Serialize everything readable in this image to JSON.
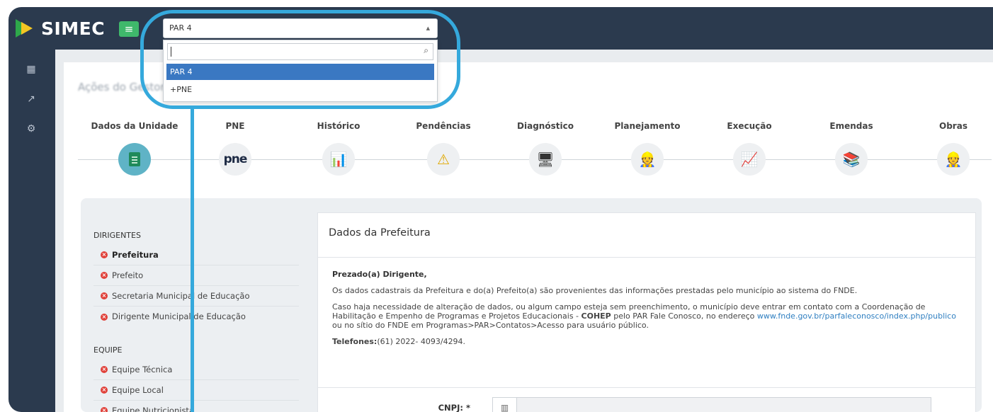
{
  "app": {
    "logo_text": "SIMEC",
    "menu_icon": "hamburger-icon"
  },
  "sidebar": {
    "icons": [
      "grid-icon",
      "chart-icon",
      "cogs-icon"
    ]
  },
  "page": {
    "title": "Ações do Gestor"
  },
  "select": {
    "value": "PAR 4",
    "search_value": "",
    "options": [
      {
        "label": "PAR 4",
        "selected": true
      },
      {
        "label": "+PNE",
        "selected": false
      }
    ]
  },
  "steps": [
    {
      "label": "Dados da Unidade",
      "icon": "document-icon",
      "active": true
    },
    {
      "label": "PNE",
      "icon": "pne-logo",
      "glyph": "pne",
      "active": false
    },
    {
      "label": "Histórico",
      "icon": "presentation-chart-icon",
      "glyph": "📊",
      "active": false
    },
    {
      "label": "Pendências",
      "icon": "warning-icon",
      "glyph": "⚠",
      "active": false
    },
    {
      "label": "Diagnóstico",
      "icon": "monitor-icon",
      "glyph": "🖥",
      "active": false
    },
    {
      "label": "Planejamento",
      "icon": "planner-person-icon",
      "glyph": "👷",
      "active": false
    },
    {
      "label": "Execução",
      "icon": "execution-chart-icon",
      "glyph": "📈",
      "active": false
    },
    {
      "label": "Emendas",
      "icon": "amendments-icon",
      "glyph": "📚",
      "active": false
    },
    {
      "label": "Obras",
      "icon": "worker-icon",
      "glyph": "👷",
      "active": false
    }
  ],
  "left_menu": {
    "sections": [
      {
        "title": "DIRIGENTES",
        "items": [
          "Prefeitura",
          "Prefeito",
          "Secretaria Municipal de Educação",
          "Dirigente Municipal de Educação"
        ]
      },
      {
        "title": "EQUIPE",
        "items": [
          "Equipe Técnica",
          "Equipe Local",
          "Equipe Nutricionista"
        ]
      }
    ]
  },
  "card": {
    "title": "Dados da Prefeitura",
    "greeting": "Prezado(a) Dirigente,",
    "paragraph1": "Os dados cadastrais da Prefeitura e do(a) Prefeito(a) são provenientes das informações prestadas pelo município ao sistema do FNDE.",
    "paragraph2_a": "Caso haja necessidade de alteração de dados, ou algum campo esteja sem preenchimento, o município deve entrar em contato com a Coordenação de Habilitação e Empenho de Programas e Projetos Educacionais - ",
    "paragraph2_bold": "COHEP",
    "paragraph2_b": " pelo PAR Fale Conosco, no endereço ",
    "paragraph2_link": "www.fnde.gov.br/parfaleconosco/index.php/publico",
    "paragraph2_c": " ou no sítio do FNDE em Programas>PAR>Contatos>Acesso para usuário público.",
    "phone_label": "Telefones:",
    "phone_value": "(61) 2022- 4093/4294.",
    "cnpj_label": "CNPJ: *",
    "cnpj_value": ""
  },
  "colors": {
    "topbar": "#2b3a4e",
    "accent_green": "#3fb86b",
    "highlight": "#35a9dc",
    "select_blue": "#3a78c2",
    "error_red": "#e0413a"
  }
}
